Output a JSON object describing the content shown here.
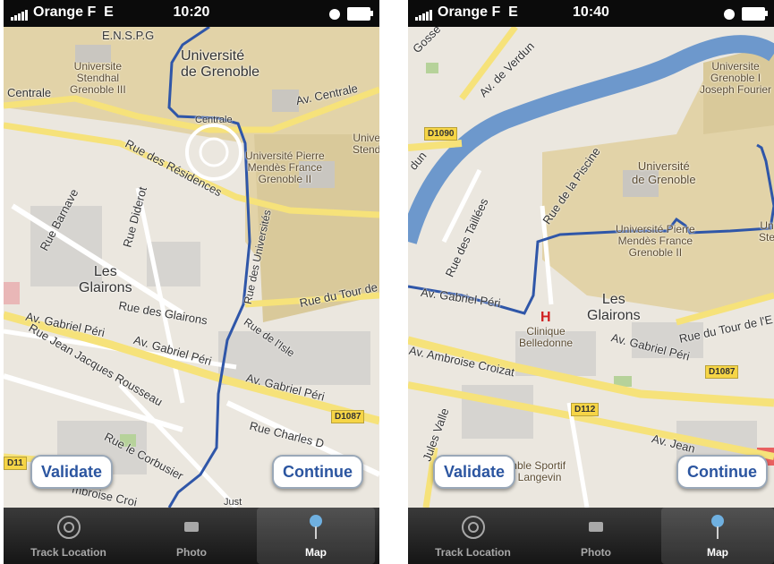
{
  "screens": [
    {
      "status": {
        "carrier": "Orange F",
        "network": "E",
        "time": "10:20"
      },
      "map_labels": {
        "ensp": "E.N.S.P.G",
        "univ_grenoble": "Université\nde Grenoble",
        "univ_stendhal": "Universite\nStendhal\nGrenoble III",
        "centrale_left": "Centrale",
        "av_centrale": "Av. Centrale",
        "centrale_small": "Centrale",
        "univ_pmf": "Université Pierre\nMendès France\nGrenoble II",
        "univ_right": "Unive\nStend",
        "rue_residences": "Rue des Résidences",
        "rue_barnave": "Rue Barnave",
        "rue_diderot": "Rue Diderot",
        "rue_universites": "Rue des Universités",
        "les_glairons": "Les\nGlairons",
        "rue_glairons": "Rue des Glairons",
        "rue_tour": "Rue du Tour de",
        "av_gabriel_peri_left": "Av. Gabriel Péri",
        "av_gabriel_peri_mid": "Av. Gabriel Péri",
        "av_gabriel_peri_right": "Av. Gabriel Péri",
        "rue_isle": "Rue de l'Isle",
        "rue_jjr": "Rue Jean Jacques Rousseau",
        "d1087": "D1087",
        "rue_corbusier": "Rue le Corbusier",
        "rue_charles": "Rue Charles D",
        "d11": "D11",
        "ambroise": "mbroise Croi",
        "just": "Just"
      },
      "buttons": {
        "validate": "Validate",
        "continue": "Continue"
      },
      "tabs": [
        {
          "label": "Track Location",
          "icon": "target-icon",
          "active": false
        },
        {
          "label": "Photo",
          "icon": "photo-icon",
          "active": false
        },
        {
          "label": "Map",
          "icon": "pin-icon",
          "active": true
        }
      ]
    },
    {
      "status": {
        "carrier": "Orange F",
        "network": "E",
        "time": "10:40"
      },
      "map_labels": {
        "gosse": "Gosse",
        "av_verdun": "Av. de Verdun",
        "univ_jf": "Universite\nGrenoble I\nJoseph Fourier",
        "d1090": "D1090",
        "dun": "dun",
        "rue_piscine": "Rue de la Piscine",
        "univ_grenoble": "Université\nde Grenoble",
        "rue_taillees": "Rue des Taillées",
        "univ_pmf": "Université Pierre\nMendès France\nGrenoble II",
        "univ_right": "Un\nSte",
        "av_gabriel_peri_left": "Av. Gabriel Péri",
        "les_glairons": "Les\nGlairons",
        "rue_tour": "Rue du Tour de l'E",
        "clinique": "Clinique\nBelledonne",
        "av_ambroise": "Av. Ambroise Croizat",
        "av_gabriel_peri_mid": "Av. Gabriel Péri",
        "d1087": "D1087",
        "d112": "D112",
        "jules": "Jules Valle",
        "av_jean": "Av. Jean",
        "sport": "mble Sportif\nl Langevin"
      },
      "buttons": {
        "validate": "Validate",
        "continue": "Continue"
      },
      "tabs": [
        {
          "label": "Track Location",
          "icon": "target-icon",
          "active": false
        },
        {
          "label": "Photo",
          "icon": "photo-icon",
          "active": false
        },
        {
          "label": "Map",
          "icon": "pin-icon",
          "active": true
        }
      ]
    }
  ],
  "colors": {
    "route": "#2f56a8",
    "road_major": "#f6e27a",
    "river": "#6d98cc",
    "campus": "#e2d3a8",
    "map_bg": "#ebe7df"
  }
}
